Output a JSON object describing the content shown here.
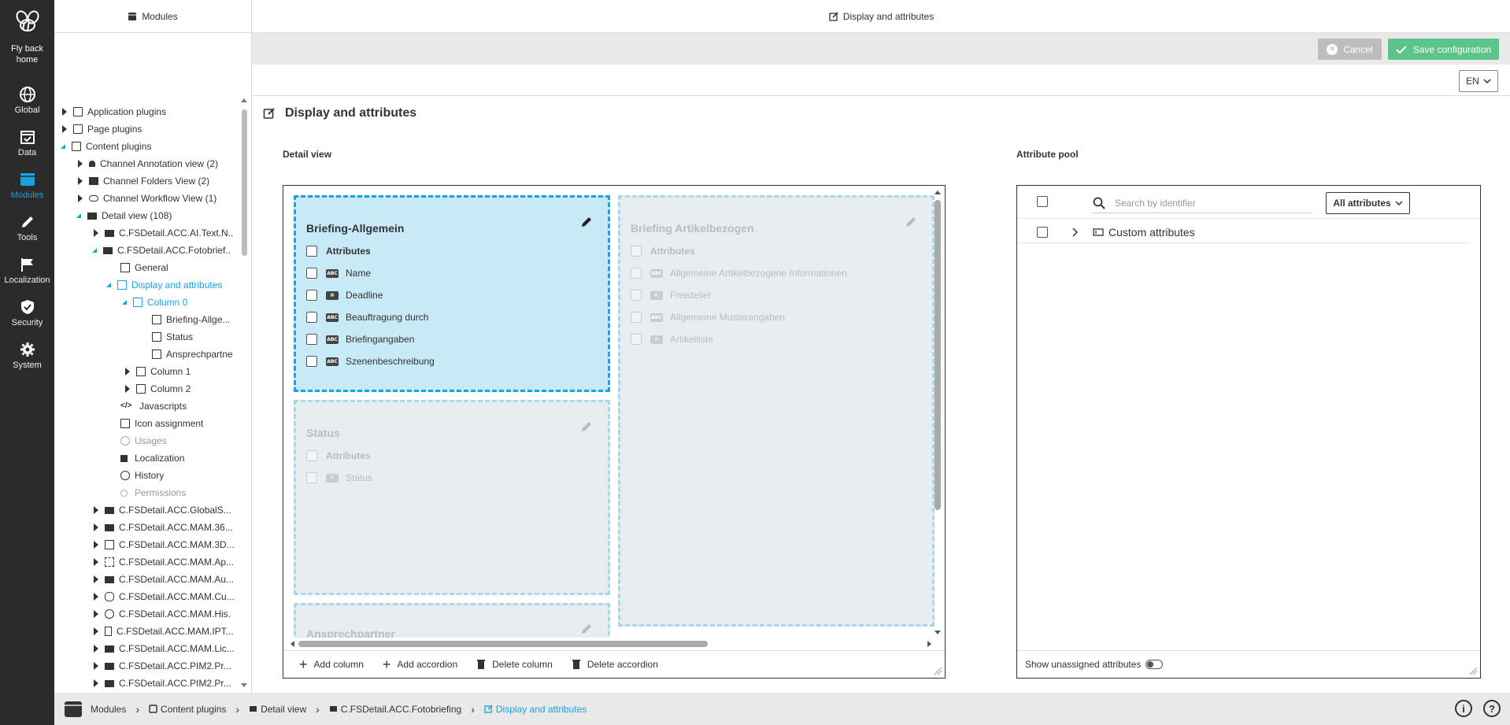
{
  "nav": {
    "logo_label": "Fly back home",
    "items": [
      {
        "label": "Global",
        "icon": "globe-icon"
      },
      {
        "label": "Data",
        "icon": "calendar-check-icon"
      },
      {
        "label": "Modules",
        "icon": "window-icon"
      },
      {
        "label": "Tools",
        "icon": "pencil-icon"
      },
      {
        "label": "Localization",
        "icon": "flag-icon"
      },
      {
        "label": "Security",
        "icon": "shield-icon"
      },
      {
        "label": "System",
        "icon": "gear-icon"
      }
    ],
    "active": "Modules",
    "accent": "#1aa2df"
  },
  "tree_header": "Modules",
  "main_header": "Display and attributes",
  "actions": {
    "cancel": "Cancel",
    "save": "Save configuration"
  },
  "language": "EN",
  "tree": [
    {
      "label": "Application plugins"
    },
    {
      "label": "Page plugins"
    },
    {
      "label": "Content plugins"
    },
    {
      "label": "Channel Annotation view (2)"
    },
    {
      "label": "Channel Folders View (2)"
    },
    {
      "label": "Channel Workflow View (1)"
    },
    {
      "label": "Detail view (108)"
    },
    {
      "label": "C.FSDetail.ACC.AI.Text.N.."
    },
    {
      "label": "C.FSDetail.ACC.Fotobrief.."
    },
    {
      "label": "General"
    },
    {
      "label": "Display and attributes"
    },
    {
      "label": "Column 0"
    },
    {
      "label": "Briefing-Allge..."
    },
    {
      "label": "Status"
    },
    {
      "label": "Ansprechpartne"
    },
    {
      "label": "Column 1"
    },
    {
      "label": "Column 2"
    },
    {
      "label": "Javascripts"
    },
    {
      "label": "Icon assignment"
    },
    {
      "label": "Usages"
    },
    {
      "label": "Localization"
    },
    {
      "label": "History"
    },
    {
      "label": "Permissions"
    },
    {
      "label": "C.FSDetail.ACC.GlobalS..."
    },
    {
      "label": "C.FSDetail.ACC.MAM.36..."
    },
    {
      "label": "C.FSDetail.ACC.MAM.3D..."
    },
    {
      "label": "C.FSDetail.ACC.MAM.Ap..."
    },
    {
      "label": "C.FSDetail.ACC.MAM.Au..."
    },
    {
      "label": "C.FSDetail.ACC.MAM.Cu..."
    },
    {
      "label": "C.FSDetail.ACC.MAM.His."
    },
    {
      "label": "C.FSDetail.ACC.MAM.IPT..."
    },
    {
      "label": "C.FSDetail.ACC.MAM.Lic..."
    },
    {
      "label": "C.FSDetail.ACC.PIM2.Pr..."
    },
    {
      "label": "C.FSDetail.ACC.PIM2.Pr..."
    }
  ],
  "page_title": "Display and attributes",
  "detail_view": {
    "label": "Detail view",
    "columns": [
      {
        "title": "Briefing-Allgemein",
        "header": "Attributes",
        "attributes": [
          "Name",
          "Deadline",
          "Beauftragung durch",
          "Briefingangaben",
          "Szenenbeschreibung"
        ]
      },
      {
        "title": "Status",
        "header": "Attributes",
        "attributes": [
          "Status"
        ]
      },
      {
        "title": "Ansprechpartner"
      },
      {
        "title": "Briefing Artikelbezogen",
        "header": "Attributes",
        "attributes": [
          "Allgemeine Artikelbezogene Informationen",
          "Freisteller",
          "Allgemeine Musterangaben",
          "Artikelliste"
        ]
      }
    ],
    "toolbar": {
      "add_column": "Add column",
      "add_accordion": "Add accordion",
      "delete_column": "Delete column",
      "delete_accordion": "Delete accordion"
    }
  },
  "attribute_pool": {
    "label": "Attribute pool",
    "search_placeholder": "Search by identifier",
    "filter": "All attributes",
    "rows": [
      "Custom attributes"
    ],
    "footer": "Show unassigned attributes"
  },
  "breadcrumb": [
    "Modules",
    "Content plugins",
    "Detail view",
    "C.FSDetail.ACC.Fotobriefing",
    "Display and attributes"
  ]
}
